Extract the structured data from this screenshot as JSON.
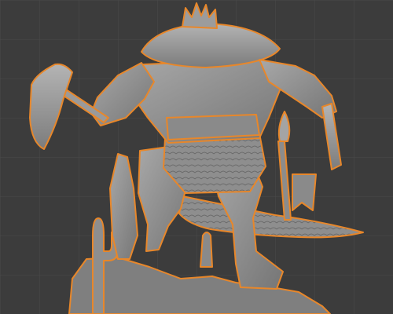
{
  "viewport": {
    "name": "3d-viewport",
    "background": "#3c3c3c",
    "grid_color": "#4a4a4a",
    "selection_outline": "#e8872a",
    "mesh_color": "#9a9a9a",
    "mesh_shadow": "#6e6e6e"
  },
  "model": {
    "icon": "sculpted-lizardfolk-warrior-model"
  }
}
